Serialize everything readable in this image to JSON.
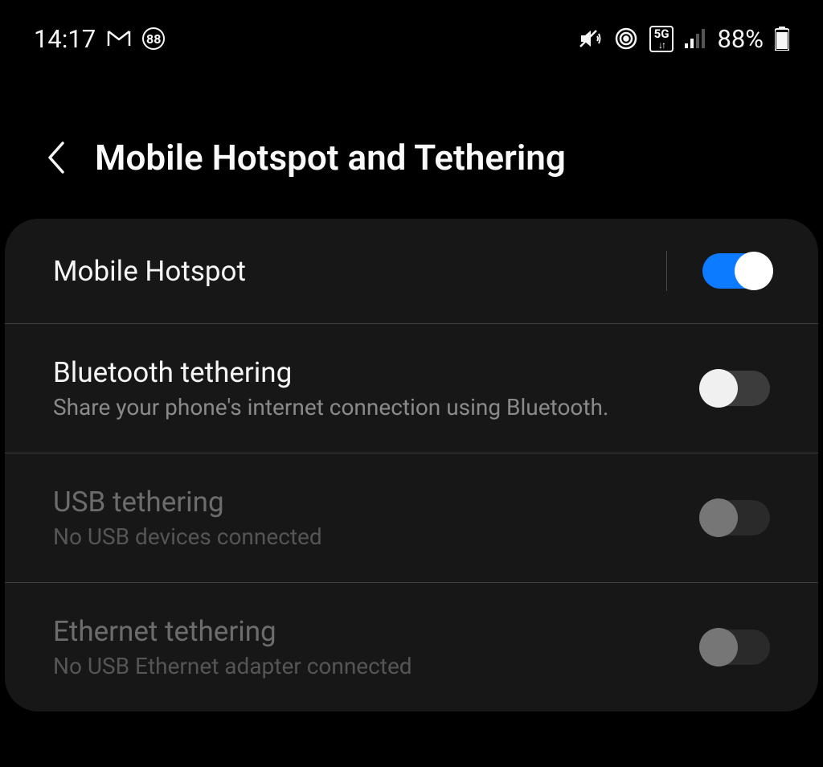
{
  "status": {
    "time": "14:17",
    "badge_count": "88",
    "battery_percent": "88%"
  },
  "header": {
    "title": "Mobile Hotspot and Tethering"
  },
  "settings": [
    {
      "title": "Mobile Hotspot",
      "subtitle": "",
      "enabled": true,
      "toggle_on": true,
      "has_divider": true
    },
    {
      "title": "Bluetooth tethering",
      "subtitle": "Share your phone's internet connection using Bluetooth.",
      "enabled": true,
      "toggle_on": false,
      "has_divider": false
    },
    {
      "title": "USB tethering",
      "subtitle": "No USB devices connected",
      "enabled": false,
      "toggle_on": false,
      "has_divider": false
    },
    {
      "title": "Ethernet tethering",
      "subtitle": "No USB Ethernet adapter connected",
      "enabled": false,
      "toggle_on": false,
      "has_divider": false
    }
  ]
}
